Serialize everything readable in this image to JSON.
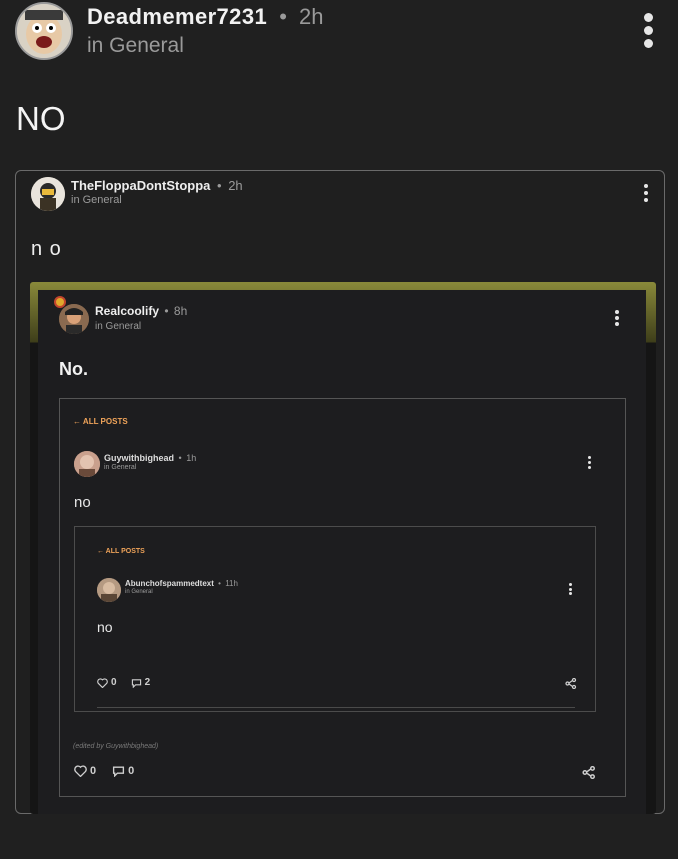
{
  "post": {
    "author": "Deadmemer7231",
    "sep": "•",
    "time": "2h",
    "location": "in General",
    "body": "NO"
  },
  "quote1": {
    "author": "TheFloppaDontStoppa",
    "sep": "•",
    "time": "2h",
    "location": "in General",
    "body": "n o"
  },
  "quote2": {
    "author": "Realcoolify",
    "sep": "•",
    "time": "8h",
    "location": "in General",
    "body": "No."
  },
  "quote3": {
    "back_label": "← ALL POSTS",
    "author": "Guywithbighead",
    "sep": "•",
    "time": "1h",
    "location": "in General",
    "body": "no",
    "edited": "(edited by Guywithbighead)",
    "likes": "0",
    "comments": "0"
  },
  "quote4": {
    "back_label": "← ALL POSTS",
    "author": "Abunchofspammedtext",
    "sep": "•",
    "time": "11h",
    "location": "in General",
    "body": "no",
    "likes": "0",
    "comments": "2"
  },
  "icons": {
    "more": "more-vertical-icon",
    "heart": "heart-icon",
    "comment": "comment-icon",
    "share": "share-icon"
  },
  "colors": {
    "background": "#202020",
    "card_border": "#6a6a6a",
    "accent_back": "#f0a45a",
    "badge": "#e0a92c"
  }
}
